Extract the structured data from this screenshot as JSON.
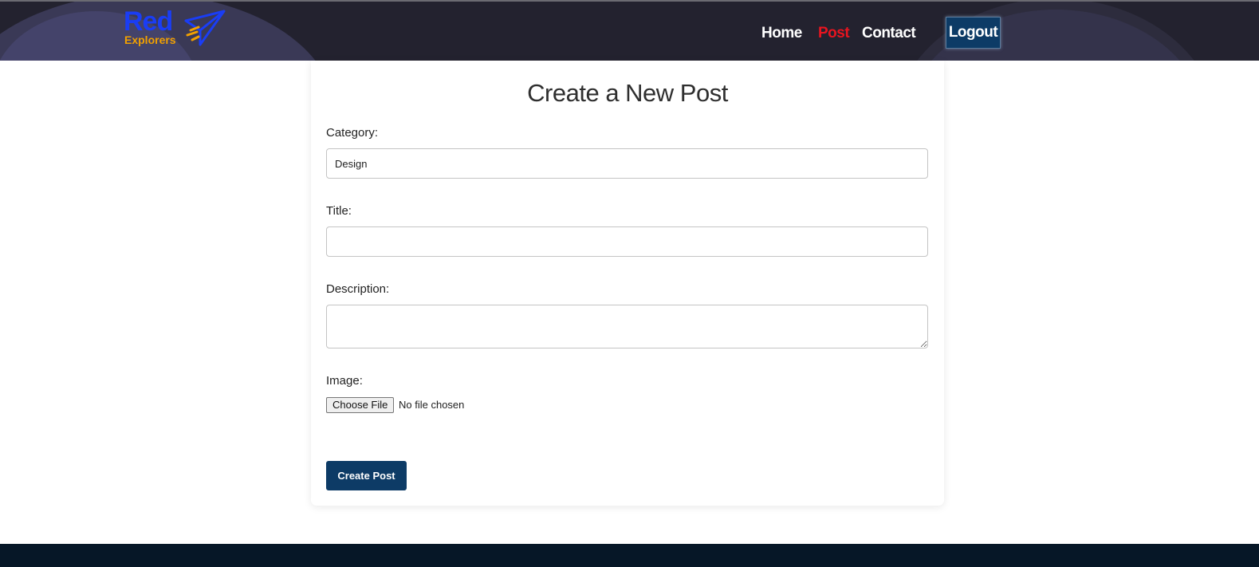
{
  "header": {
    "logo": {
      "word": "Red",
      "subword": "Explorers"
    },
    "nav": [
      {
        "label": "Home",
        "active": false
      },
      {
        "label": "Post",
        "active": true
      },
      {
        "label": "Contact",
        "active": false
      }
    ],
    "logout_label": "Logout"
  },
  "form": {
    "title": "Create a New Post",
    "category": {
      "label": "Category:",
      "value": "Design"
    },
    "title_field": {
      "label": "Title:",
      "value": ""
    },
    "description": {
      "label": "Description:",
      "value": ""
    },
    "image": {
      "label": "Image:",
      "button_label": "Choose File",
      "status": "No file chosen"
    },
    "submit_label": "Create Post"
  },
  "colors": {
    "header_bg": "#23222f",
    "brand_blue": "#1a3df5",
    "brand_orange": "#f1a000",
    "active_nav": "#e8141f",
    "primary_button": "#0d3b66",
    "footer_bg": "#061727"
  }
}
